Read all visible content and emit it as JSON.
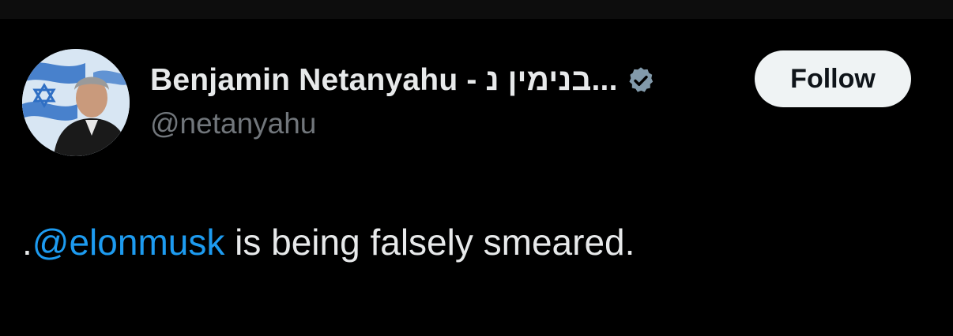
{
  "tweet": {
    "author": {
      "display_name": "Benjamin Netanyahu - בנימין נ...",
      "handle": "@netanyahu",
      "verified": true,
      "verified_badge_color": "#829aab"
    },
    "follow_button": {
      "label": "Follow"
    },
    "body": {
      "prefix": ".",
      "mention": "@elonmusk",
      "text": " is being falsely smeared."
    }
  },
  "colors": {
    "background": "#000000",
    "text_primary": "#e7e9ea",
    "text_secondary": "#71767b",
    "mention": "#1d9bf0",
    "button_bg": "#eff3f4",
    "button_text": "#0f1419"
  }
}
